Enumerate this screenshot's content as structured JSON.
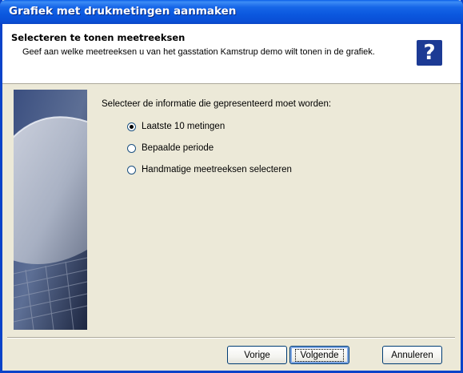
{
  "window": {
    "title": "Grafiek met drukmetingen aanmaken"
  },
  "header": {
    "title": "Selecteren te tonen meetreeksen",
    "subtitle": "Geef aan welke meetreeksen u van het gasstation Kamstrup demo wilt tonen in de grafiek.",
    "help_icon": "question-mark-icon"
  },
  "main": {
    "prompt": "Selecteer de informatie die gepresenteerd moet worden:",
    "options": [
      {
        "label": "Laatste 10 metingen",
        "checked": true
      },
      {
        "label": "Bepaalde periode",
        "checked": false
      },
      {
        "label": "Handmatige meetreeksen selecteren",
        "checked": false
      }
    ]
  },
  "buttons": {
    "back": "Vorige",
    "next": "Volgende",
    "cancel": "Annuleren"
  }
}
